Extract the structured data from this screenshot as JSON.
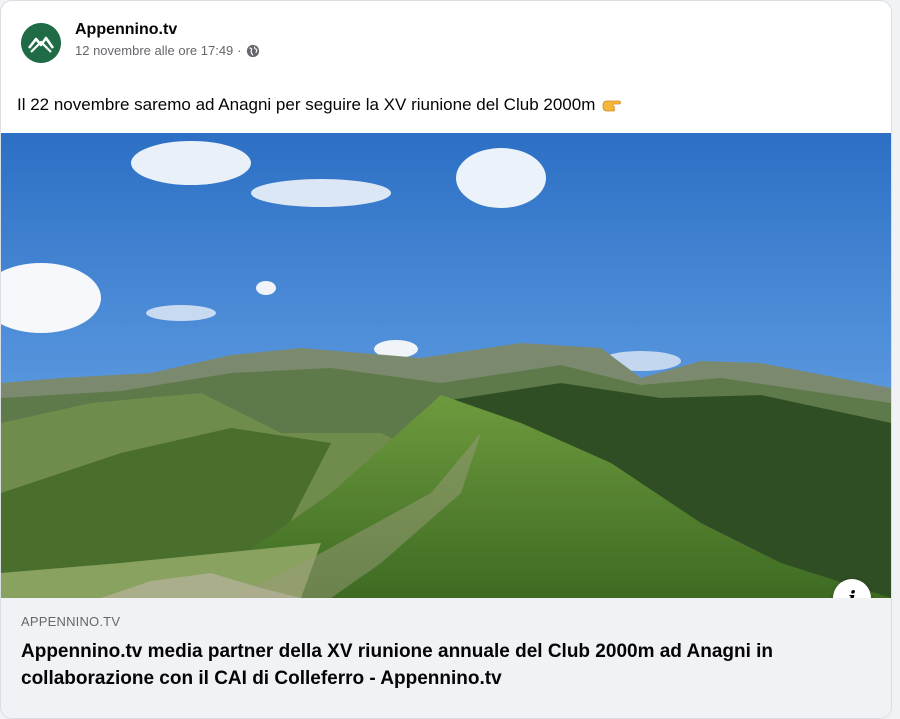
{
  "post": {
    "page_name": "Appennino.tv",
    "timestamp": "12 novembre alle ore 17:49",
    "separator": "·",
    "audience_icon": "globe-icon",
    "text": "Il 22 novembre saremo ad Anagni per seguire la XV riunione del Club 2000m",
    "emoji_icon": "backhand-index-pointing-right-icon"
  },
  "link_preview": {
    "domain": "APPENNINO.TV",
    "title": "Appennino.tv media partner della XV riunione annuale del Club 2000m ad Anagni in collaborazione con il CAI di Colleferro - Appennino.tv",
    "info_label": "i"
  },
  "colors": {
    "avatar_bg": "#1f6b45",
    "preview_bg": "#f0f2f5",
    "secondary_text": "#65676b"
  }
}
